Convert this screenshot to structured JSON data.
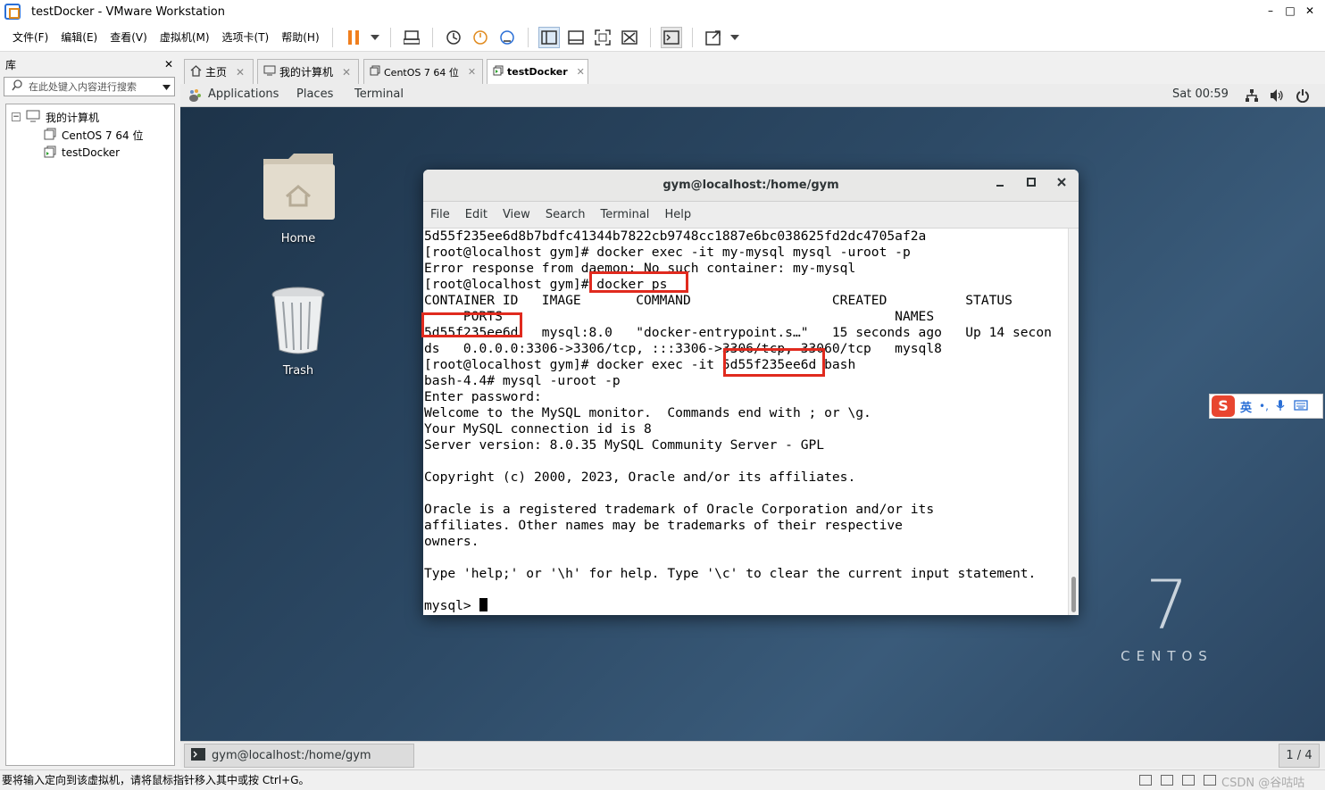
{
  "window": {
    "title": "testDocker - VMware Workstation"
  },
  "menubar": {
    "items": [
      "文件(F)",
      "编辑(E)",
      "查看(V)",
      "虚拟机(M)",
      "选项卡(T)",
      "帮助(H)"
    ]
  },
  "library": {
    "header": "库",
    "search_placeholder": "在此处键入内容进行搜索",
    "tree": {
      "root": "我的计算机",
      "children": [
        "CentOS 7 64 位",
        "testDocker"
      ]
    }
  },
  "tabs": [
    {
      "label": "主页",
      "icon": "home-icon"
    },
    {
      "label": "我的计算机",
      "icon": "computer-icon"
    },
    {
      "label": "CentOS 7 64 位",
      "icon": "vm-icon"
    },
    {
      "label": "testDocker",
      "icon": "vm-running-icon"
    }
  ],
  "gnome": {
    "applications": "Applications",
    "places": "Places",
    "terminal": "Terminal",
    "clock": "Sat 00:59"
  },
  "desktop": {
    "home_label": "Home",
    "trash_label": "Trash",
    "centos_number": "7",
    "centos_text": "CENTOS"
  },
  "terminal": {
    "title": "gym@localhost:/home/gym",
    "menu": [
      "File",
      "Edit",
      "View",
      "Search",
      "Terminal",
      "Help"
    ],
    "lines": [
      "5d55f235ee6d8b7bdfc41344b7822cb9748cc1887e6bc038625fd2dc4705af2a",
      "[root@localhost gym]# docker exec -it my-mysql mysql -uroot -p",
      "Error response from daemon: No such container: my-mysql",
      "[root@localhost gym]# docker ps",
      "CONTAINER ID   IMAGE       COMMAND                  CREATED          STATUS",
      "     PORTS                                                  NAMES",
      "5d55f235ee6d   mysql:8.0   \"docker-entrypoint.s…\"   15 seconds ago   Up 14 secon",
      "ds   0.0.0.0:3306->3306/tcp, :::3306->3306/tcp, 33060/tcp   mysql8",
      "[root@localhost gym]# docker exec -it 5d55f235ee6d bash",
      "bash-4.4# mysql -uroot -p",
      "Enter password:",
      "Welcome to the MySQL monitor.  Commands end with ; or \\g.",
      "Your MySQL connection id is 8",
      "Server version: 8.0.35 MySQL Community Server - GPL",
      "",
      "Copyright (c) 2000, 2023, Oracle and/or its affiliates.",
      "",
      "Oracle is a registered trademark of Oracle Corporation and/or its",
      "affiliates. Other names may be trademarks of their respective",
      "owners.",
      "",
      "Type 'help;' or '\\h' for help. Type '\\c' to clear the current input statement.",
      "",
      "mysql> "
    ]
  },
  "ime": {
    "lang": "英",
    "punct": "•,"
  },
  "taskbar": {
    "item": "gym@localhost:/home/gym",
    "workspace": "1 / 4"
  },
  "statusbar": {
    "hint": "要将输入定向到该虚拟机，请将鼠标指针移入其中或按 Ctrl+G。",
    "watermark": "CSDN @谷咕咕"
  },
  "colors": {
    "annotation_red": "#e02a1e",
    "pause_orange": "#f07f1e"
  }
}
